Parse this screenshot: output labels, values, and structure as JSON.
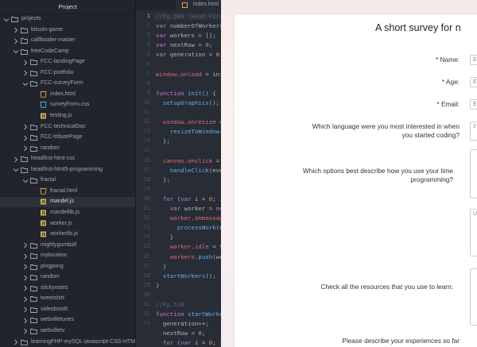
{
  "sidebar": {
    "title": "Project",
    "items": [
      {
        "label": "projects",
        "indent": 0,
        "type": "folder",
        "open": true
      },
      {
        "label": "bitcoin-game",
        "indent": 1,
        "type": "folder",
        "open": false
      },
      {
        "label": "callflooder-master",
        "indent": 1,
        "type": "folder",
        "open": false
      },
      {
        "label": "freeCodeCamp",
        "indent": 1,
        "type": "folder",
        "open": true
      },
      {
        "label": "FCC-landingPage",
        "indent": 2,
        "type": "folder",
        "open": false
      },
      {
        "label": "FCC-portfolio",
        "indent": 2,
        "type": "folder",
        "open": false
      },
      {
        "label": "FCC-surveyForm",
        "indent": 2,
        "type": "folder",
        "open": true
      },
      {
        "label": "index.html",
        "indent": 3,
        "type": "html"
      },
      {
        "label": "surveyForm.css",
        "indent": 3,
        "type": "css"
      },
      {
        "label": "testing.js",
        "indent": 3,
        "type": "js"
      },
      {
        "label": "FCC-technicalDoc",
        "indent": 2,
        "type": "folder",
        "open": false
      },
      {
        "label": "FCC-tributePage",
        "indent": 2,
        "type": "folder",
        "open": false
      },
      {
        "label": "random",
        "indent": 2,
        "type": "folder",
        "open": false
      },
      {
        "label": "headfirst-html-css",
        "indent": 1,
        "type": "folder",
        "open": false
      },
      {
        "label": "headfirst-html5-programming",
        "indent": 1,
        "type": "folder",
        "open": true
      },
      {
        "label": "fractal",
        "indent": 2,
        "type": "folder",
        "open": true
      },
      {
        "label": "fractal.html",
        "indent": 3,
        "type": "html"
      },
      {
        "label": "mandel.js",
        "indent": 3,
        "type": "js",
        "selected": true
      },
      {
        "label": "mandellib.js",
        "indent": 3,
        "type": "js"
      },
      {
        "label": "worker.js",
        "indent": 3,
        "type": "js"
      },
      {
        "label": "workerlib.js",
        "indent": 3,
        "type": "js"
      },
      {
        "label": "mightygumball",
        "indent": 2,
        "type": "folder",
        "open": false
      },
      {
        "label": "mylocation",
        "indent": 2,
        "type": "folder",
        "open": false
      },
      {
        "label": "pingpong",
        "indent": 2,
        "type": "folder",
        "open": false
      },
      {
        "label": "random",
        "indent": 2,
        "type": "folder",
        "open": false
      },
      {
        "label": "stickynotes",
        "indent": 2,
        "type": "folder",
        "open": false
      },
      {
        "label": "tweetshirt",
        "indent": 2,
        "type": "folder",
        "open": false
      },
      {
        "label": "videobooth",
        "indent": 2,
        "type": "folder",
        "open": false
      },
      {
        "label": "webvilletunes",
        "indent": 2,
        "type": "folder",
        "open": false
      },
      {
        "label": "webvilletv",
        "indent": 2,
        "type": "folder",
        "open": false
      },
      {
        "label": "learningPHP-mySQL-javascript-CSS-HTML5",
        "indent": 1,
        "type": "folder",
        "open": false
      }
    ]
  },
  "editor": {
    "tab_label": "index.html",
    "line_numbers": [
      "1",
      "2",
      "3",
      "4",
      "5",
      "6",
      "7",
      "8",
      "9",
      "10",
      "11",
      "12",
      "13",
      "14",
      "15",
      "16",
      "17",
      "18",
      "19",
      "20",
      "21",
      "22",
      "23",
      "24",
      "25",
      "26",
      "27",
      "28",
      "29",
      "30",
      "31",
      "32",
      "33"
    ],
    "active_line": "1",
    "lines": [
      [
        [
          "c",
          "//Pg.500 'Head First HTML5'"
        ]
      ],
      [
        [
          "k",
          "var "
        ],
        [
          "p",
          "numberOfWorkers"
        ]
      ],
      [
        [
          "k",
          "var "
        ],
        [
          "p",
          "workers = [];"
        ]
      ],
      [
        [
          "k",
          "var "
        ],
        [
          "p",
          "nextRow = "
        ],
        [
          "n",
          "0"
        ],
        [
          "p",
          ";"
        ]
      ],
      [
        [
          "k",
          "var "
        ],
        [
          "p",
          "generation = "
        ],
        [
          "n",
          "0"
        ],
        [
          "p",
          ";"
        ]
      ],
      [],
      [
        [
          "v",
          "window"
        ],
        [
          "p",
          "."
        ],
        [
          "v",
          "onload"
        ],
        [
          "p",
          " = init"
        ]
      ],
      [],
      [
        [
          "k",
          "function "
        ],
        [
          "f",
          "init"
        ],
        [
          "p",
          "() {"
        ]
      ],
      [
        [
          "p",
          "  "
        ],
        [
          "f",
          "setupGraphics"
        ],
        [
          "p",
          "();"
        ]
      ],
      [],
      [
        [
          "p",
          "  "
        ],
        [
          "v",
          "window"
        ],
        [
          "p",
          "."
        ],
        [
          "v",
          "onresize"
        ],
        [
          "p",
          " ="
        ]
      ],
      [
        [
          "p",
          "    "
        ],
        [
          "f",
          "resizeToWindow"
        ],
        [
          "p",
          "("
        ]
      ],
      [
        [
          "p",
          "  };"
        ]
      ],
      [],
      [
        [
          "p",
          "  "
        ],
        [
          "v",
          "canvas"
        ],
        [
          "p",
          "."
        ],
        [
          "v",
          "onclick"
        ],
        [
          "p",
          " ="
        ]
      ],
      [
        [
          "p",
          "    "
        ],
        [
          "f",
          "handleClick"
        ],
        [
          "p",
          "(even"
        ]
      ],
      [
        [
          "p",
          "  };"
        ]
      ],
      [],
      [
        [
          "p",
          "  "
        ],
        [
          "k",
          "for "
        ],
        [
          "p",
          "("
        ],
        [
          "k",
          "var "
        ],
        [
          "p",
          "i = "
        ],
        [
          "n",
          "0"
        ],
        [
          "p",
          "; i"
        ]
      ],
      [
        [
          "p",
          "    "
        ],
        [
          "k",
          "var "
        ],
        [
          "p",
          "worker = "
        ],
        [
          "k",
          "ne"
        ]
      ],
      [
        [
          "p",
          "    "
        ],
        [
          "v",
          "worker"
        ],
        [
          "p",
          "."
        ],
        [
          "v",
          "onmessag"
        ]
      ],
      [
        [
          "p",
          "      "
        ],
        [
          "f",
          "processWork"
        ],
        [
          "p",
          "(e"
        ]
      ],
      [
        [
          "p",
          "    }"
        ]
      ],
      [
        [
          "p",
          "    "
        ],
        [
          "v",
          "worker"
        ],
        [
          "p",
          "."
        ],
        [
          "v",
          "idle"
        ],
        [
          "p",
          " = t"
        ]
      ],
      [
        [
          "p",
          "    "
        ],
        [
          "v",
          "workers"
        ],
        [
          "p",
          "."
        ],
        [
          "f",
          "push"
        ],
        [
          "p",
          "(wo"
        ]
      ],
      [
        [
          "p",
          "  }"
        ]
      ],
      [
        [
          "p",
          "  "
        ],
        [
          "f",
          "startWorkers"
        ],
        [
          "p",
          "();"
        ]
      ],
      [
        [
          "p",
          "}"
        ]
      ],
      [],
      [
        [
          "c",
          "//Pg.510"
        ]
      ],
      [
        [
          "k",
          "function "
        ],
        [
          "f",
          "startWorke"
        ]
      ],
      [
        [
          "p",
          "  generation++;"
        ]
      ],
      [
        [
          "p",
          "  nextRow = "
        ],
        [
          "n",
          "0"
        ],
        [
          "p",
          ";"
        ]
      ],
      [
        [
          "p",
          "  "
        ],
        [
          "k",
          "for "
        ],
        [
          "p",
          "("
        ],
        [
          "k",
          "var "
        ],
        [
          "p",
          "i = "
        ],
        [
          "n",
          "0"
        ],
        [
          "p",
          "; i"
        ]
      ]
    ]
  },
  "survey": {
    "title": "A short survey for n",
    "questions": [
      {
        "label": "* Name:",
        "placeholder": "E"
      },
      {
        "label": "* Age:",
        "placeholder": "E"
      },
      {
        "label": "* Email:",
        "placeholder": "E"
      },
      {
        "label": "Which language were you most interested in when you started coding?",
        "placeholder": "J"
      },
      {
        "label": "Which options best describe how you use your time programming?",
        "placeholder": ""
      },
      {
        "label": "Check all the resources that you use to learn:",
        "placeholder": "U"
      },
      {
        "label": "Please describe your experiences so far",
        "placeholder": ""
      }
    ]
  },
  "colors": {
    "sidebar_bg": "#21252b",
    "editor_bg": "#282c34",
    "selected_row": "#2c313a",
    "page_bg": "#f6eae8"
  },
  "icons": {
    "folder": "folder-icon",
    "html": "html-file-icon",
    "css": "css-file-icon",
    "js": "js-file-icon",
    "chevron_open": "chevron-down-icon",
    "chevron_closed": "chevron-right-icon"
  }
}
